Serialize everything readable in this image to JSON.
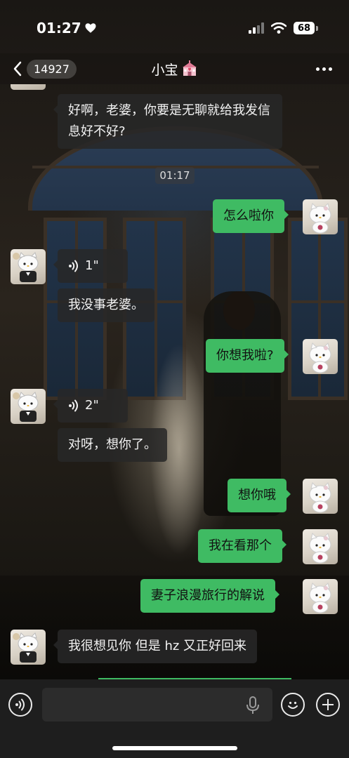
{
  "status_bar": {
    "time": "01:27",
    "battery": "68"
  },
  "header": {
    "unread_count": "14927",
    "title": "小宝"
  },
  "timestamp": "01:17",
  "messages": [
    {
      "side": "in",
      "text": "好啊，老婆，你要是无聊就给我发信息好不好?"
    },
    {
      "side": "out",
      "text": "怎么啦你"
    },
    {
      "side": "in",
      "type": "voice",
      "duration": "1\""
    },
    {
      "side": "in",
      "text": "我没事老婆。"
    },
    {
      "side": "out",
      "text": "你想我啦?"
    },
    {
      "side": "in",
      "type": "voice",
      "duration": "2\""
    },
    {
      "side": "in",
      "text": "对呀，想你了。"
    },
    {
      "side": "out",
      "text": "想你哦"
    },
    {
      "side": "out",
      "text": "我在看那个"
    },
    {
      "side": "out",
      "text": "妻子浪漫旅行的解说"
    },
    {
      "side": "in",
      "text": "我很想见你 但是 hz 又正好回来"
    }
  ],
  "colors": {
    "outgoing_bubble": "#3fbb63",
    "incoming_bubble": "#282828"
  },
  "icons": {
    "title_emoji": "wedding-chapel-icon",
    "back": "chevron-left-icon",
    "more": "more-dots-icon",
    "voice_toggle": "voice-wave-icon",
    "mic": "mic-icon",
    "emoji": "smiley-icon",
    "plus": "plus-icon"
  }
}
